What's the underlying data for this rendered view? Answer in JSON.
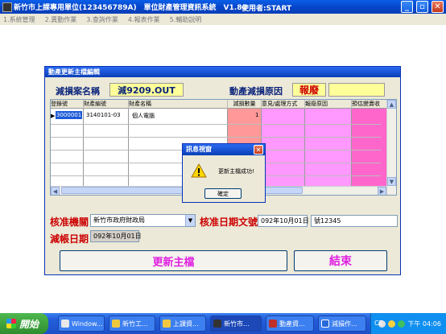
{
  "window": {
    "title": "新竹市上課專用單位(123456789A)　單位財產管理資訊系統　V1.80",
    "user": "使用者:START"
  },
  "menu": {
    "items": [
      "1.系統管理",
      "2.異動作業",
      "3.查詢作業",
      "4.報表作業",
      "5.輔助說明"
    ]
  },
  "dialog": {
    "title": "動產更新主檔編輯",
    "case_name_label": "減損案名稱",
    "case_name_value": "減9209.OUT",
    "reason_label": "動產減損原因",
    "reason_value": "報廢",
    "reason_extra": "",
    "grid": {
      "headers": [
        "登錄號",
        "財產編號",
        "財產名稱",
        "減損數量",
        "意見/處理方式",
        "報廢原因",
        "預估變賣收"
      ],
      "rows": [
        {
          "reg_no": "3000001",
          "prop_no": "3140101-03",
          "name": "個人電腦",
          "qty": "1"
        }
      ],
      "colors": {
        "qty_bg": "#ff9999",
        "opinion_bg": "#ff99ff",
        "reason_bg": "#ff66cc"
      }
    },
    "approval_agency_label": "核准機關",
    "approval_agency_value": "新竹市政府財政局",
    "approval_date_label": "核准日期文號",
    "approval_date_value": "092年10月01日",
    "approval_doc_value": "號12345",
    "writeoff_date_label": "減帳日期",
    "writeoff_date_value": "092年10月01日",
    "update_button": "更新主檔",
    "close_button": "結束"
  },
  "message_box": {
    "title": "訊息視窗",
    "text": "更新主檔成功!",
    "ok_button": "確定"
  },
  "taskbar": {
    "start": "開始",
    "tasks": [
      "Window...",
      "新竹工...",
      "上課資...",
      "新竹市...",
      "動產資...",
      "減損作..."
    ],
    "tray_text": "CE",
    "clock": "下午 04:06"
  }
}
